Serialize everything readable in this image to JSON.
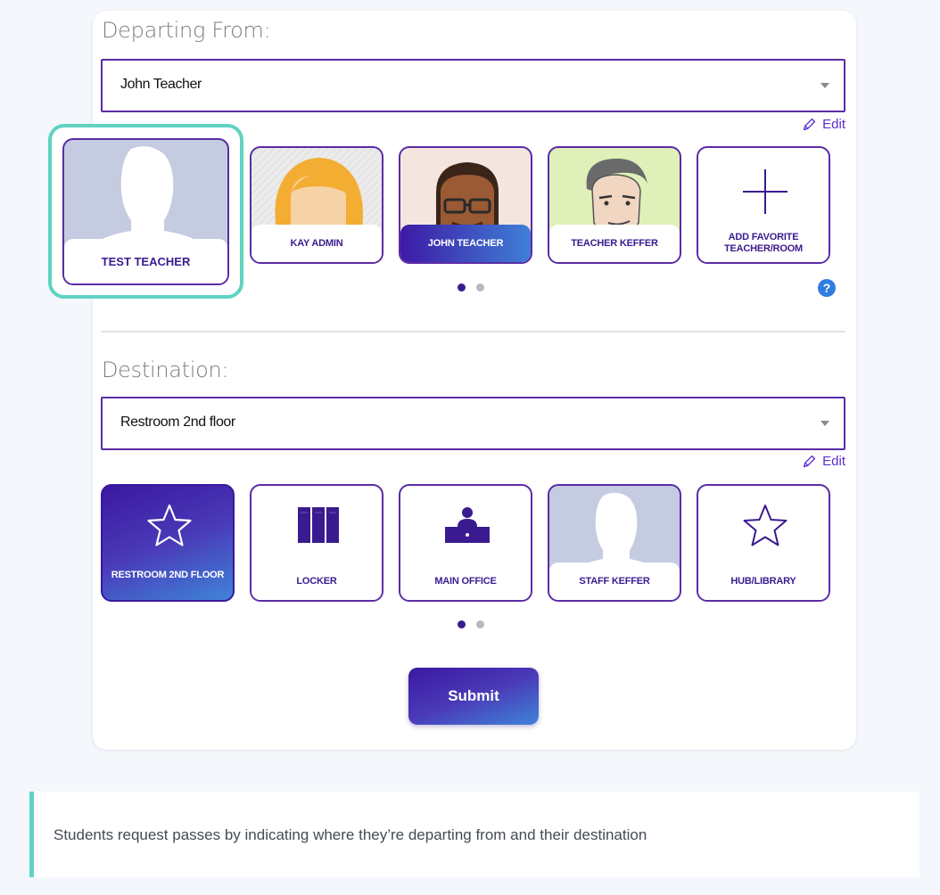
{
  "departing": {
    "title": "Departing From:",
    "selected": "John Teacher",
    "edit_label": "Edit",
    "favorites": [
      {
        "label": "TEST TEACHER"
      },
      {
        "label": "KAY ADMIN"
      },
      {
        "label": "JOHN TEACHER"
      },
      {
        "label": "TEACHER KEFFER"
      },
      {
        "label": "ADD FAVORITE TEACHER/ROOM"
      }
    ],
    "help_icon": "?"
  },
  "destination": {
    "title": "Destination:",
    "selected": "Restroom 2nd floor",
    "edit_label": "Edit",
    "favorites": [
      {
        "label": "RESTROOM 2ND FLOOR",
        "icon": "star-icon"
      },
      {
        "label": "LOCKER",
        "icon": "locker-icon"
      },
      {
        "label": "MAIN OFFICE",
        "icon": "desk-icon"
      },
      {
        "label": "STAFF KEFFER",
        "icon": "person-silhouette"
      },
      {
        "label": "HUB/LIBRARY",
        "icon": "star-icon"
      }
    ]
  },
  "submit_label": "Submit",
  "caption": "Students request passes by indicating where they’re departing from and their destination",
  "colors": {
    "primary": "#3a1b8f",
    "accent": "#5fd3c2",
    "border": "#5a2ca6",
    "help": "#2f7de0"
  }
}
